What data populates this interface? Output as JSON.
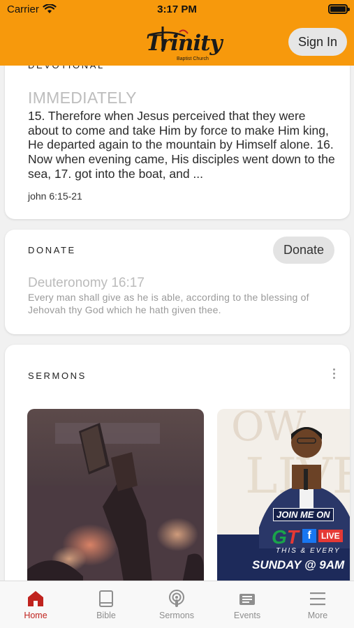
{
  "status_bar": {
    "carrier": "Carrier",
    "time": "3:17 PM"
  },
  "header": {
    "logo_text": "Trinity",
    "logo_subtitle": "Baptist Church",
    "sign_in_label": "Sign In",
    "background_color": "#f7990c"
  },
  "devotional": {
    "title": "DEVOTIONAL",
    "heading": "IMMEDIATELY",
    "body": "15. Therefore when Jesus perceived that they were about to come and take Him by force to make Him king, He departed again to the mountain by Himself alone. 16. Now when evening came, His disciples went down to the sea, 17. got into the boat, and ...",
    "reference": "john 6:15-21"
  },
  "donate": {
    "title": "DONATE",
    "button_label": "Donate",
    "heading": "Deuteronomy 16:17",
    "body": "Every man shall give as he is able, according to the blessing of Jehovah thy God which he hath given thee."
  },
  "sermons": {
    "title": "SERMONS",
    "items": [
      {
        "image": "worship-hands-bible-photo"
      },
      {
        "image": "preacher-flyer",
        "join_text": "JOIN ME ON",
        "live_text": "LIVE",
        "this_every": "THIS & EVERY",
        "day_text": "SUNDAY @ 9AM"
      }
    ]
  },
  "tabs": [
    {
      "label": "Home",
      "icon": "home-icon",
      "active": true
    },
    {
      "label": "Bible",
      "icon": "book-icon",
      "active": false
    },
    {
      "label": "Sermons",
      "icon": "podcast-icon",
      "active": false
    },
    {
      "label": "Events",
      "icon": "newspaper-icon",
      "active": false
    },
    {
      "label": "More",
      "icon": "menu-icon",
      "active": false
    }
  ],
  "colors": {
    "accent": "#c0231e",
    "header": "#f7990c",
    "inactive_tab": "#8e8e8e"
  }
}
